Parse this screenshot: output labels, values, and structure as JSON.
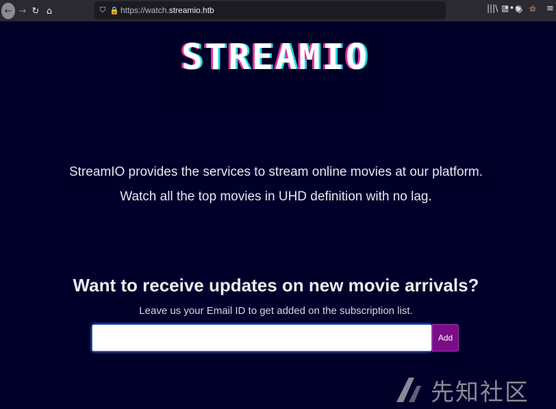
{
  "browser": {
    "url_prefix": "https://watch.",
    "url_host": "streamio.htb",
    "icons": {
      "back": "←",
      "forward": "→",
      "reload": "↻",
      "home": "⌂",
      "shield": "⛉",
      "lock": "🔒",
      "more": "•••",
      "pocket": "◇",
      "star": "☆",
      "library": "|||\\",
      "sidebar": "▥",
      "account": "◉",
      "extension": "♨",
      "menu": "≡"
    }
  },
  "page": {
    "logo": "STREAMIO",
    "intro_line1": "StreamIO provides the services to stream online movies at our platform.",
    "intro_line2": "Watch all the top movies in UHD definition with no lag.",
    "subscribe_heading": "Want to receive updates on new movie arrivals?",
    "subscribe_sub": "Leave us your Email ID to get added on the subscription list.",
    "email_value": "",
    "add_label": "Add"
  },
  "watermark": {
    "text": "先知社区"
  },
  "colors": {
    "background": "#00002b",
    "add_button": "#7b0d86",
    "logo_magenta": "#e0339f",
    "logo_cyan": "#22d6e0"
  }
}
